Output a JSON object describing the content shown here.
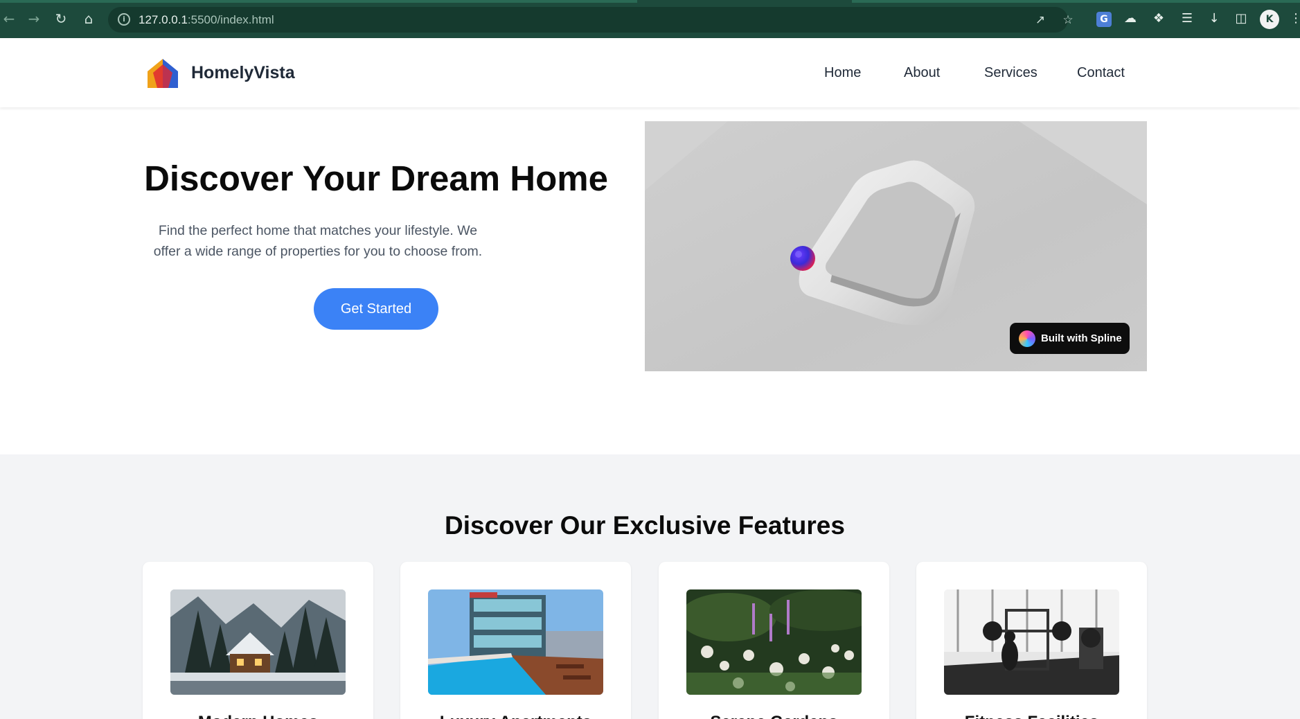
{
  "browser": {
    "url_host": "127.0.0.1",
    "url_rest": ":5500/index.html",
    "profile_initial": "K"
  },
  "site": {
    "brand": "HomelyVista",
    "nav": [
      "Home",
      "About",
      "Services",
      "Contact"
    ]
  },
  "hero": {
    "title": "Discover Your Dream Home",
    "description_line1": "Find the perfect home that matches your lifestyle. We",
    "description_line2": "offer a wide range of properties for you to choose from.",
    "cta_label": "Get Started",
    "badge_label": "Built with Spline"
  },
  "features": {
    "title": "Discover Our Exclusive Features",
    "cards": [
      {
        "title": "Modern Homes",
        "image": "snowy-cabin"
      },
      {
        "title": "Luxury Apartments",
        "image": "rooftop-pool"
      },
      {
        "title": "Serene Gardens",
        "image": "wildflowers"
      },
      {
        "title": "Fitness Facilities",
        "image": "gym"
      }
    ]
  },
  "colors": {
    "chrome": "#1d4a3c",
    "accent": "#3b82f6",
    "scene_bg": "#c8c8c8",
    "features_bg": "#f3f4f6"
  }
}
